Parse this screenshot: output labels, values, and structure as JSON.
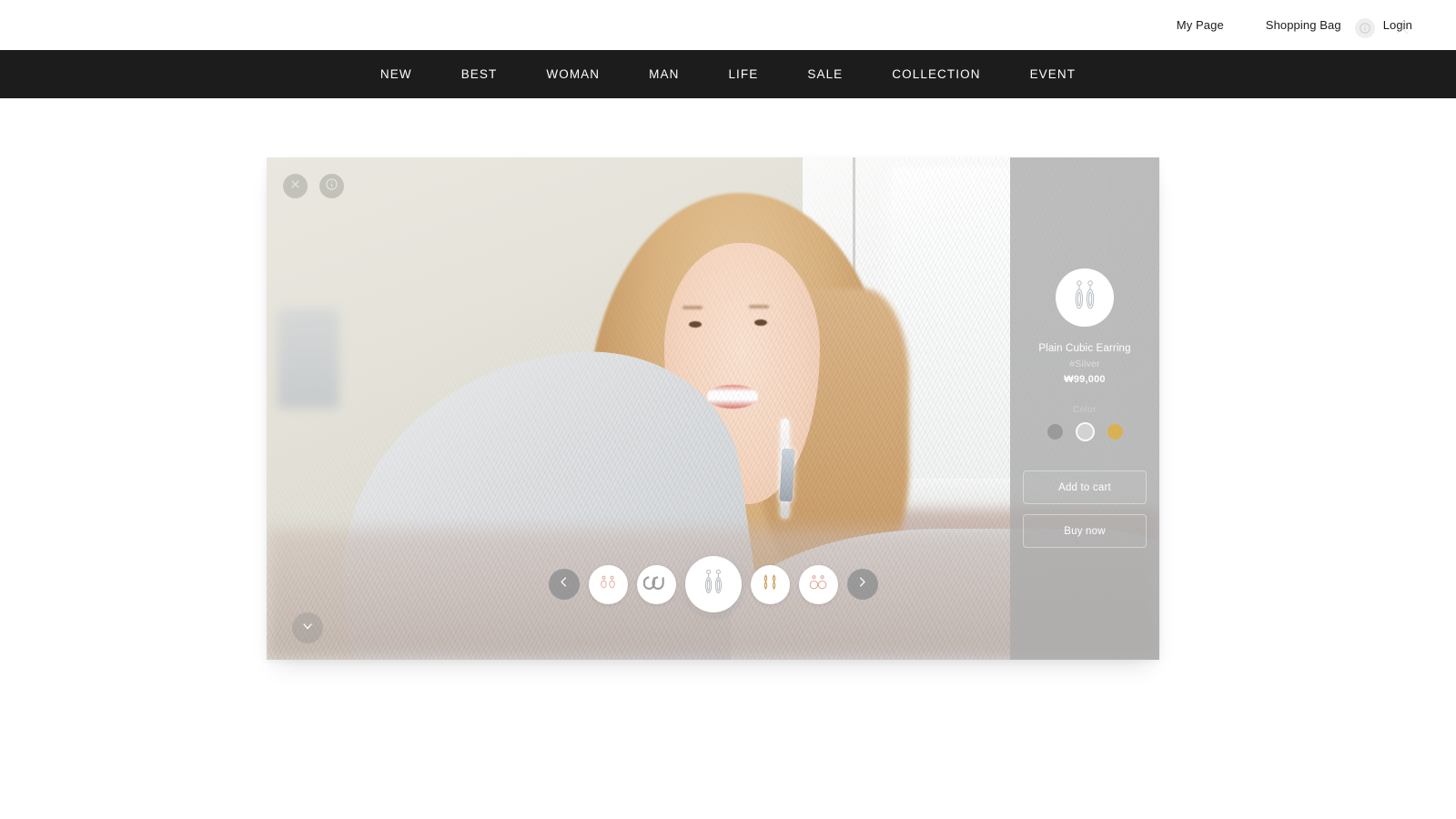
{
  "header": {
    "links": [
      {
        "label": "My Page"
      },
      {
        "label": "Shopping Bag"
      },
      {
        "label": "Login"
      }
    ],
    "overlay_icons": {
      "info": "info-circle-icon",
      "close": "close-icon"
    }
  },
  "nav": {
    "items": [
      {
        "label": "NEW"
      },
      {
        "label": "BEST"
      },
      {
        "label": "WOMAN"
      },
      {
        "label": "MAN"
      },
      {
        "label": "LIFE"
      },
      {
        "label": "SALE"
      },
      {
        "label": "COLLECTION"
      },
      {
        "label": "EVENT"
      }
    ],
    "background": "#1c1c1c",
    "text_color": "#ffffff"
  },
  "viewer": {
    "controls": {
      "close": "close-icon",
      "info": "info-circle-icon",
      "scroll_down": "chevron-down-icon",
      "prev": "chevron-left-icon",
      "next": "chevron-right-icon"
    },
    "thumbnails": [
      {
        "name": "rose-drop-earring",
        "active": false
      },
      {
        "name": "silver-hoop-earring",
        "active": false
      },
      {
        "name": "plain-cubic-earring",
        "active": true
      },
      {
        "name": "gold-twist-earring",
        "active": false
      },
      {
        "name": "rose-hoop-earring",
        "active": false
      }
    ]
  },
  "product": {
    "thumb_icon": "earring-pair-icon",
    "title": "Plain Cubic Earring",
    "tag": "#Silver",
    "price": "₩99,000",
    "color_label": "Color",
    "colors": [
      {
        "name": "gray",
        "hex": "#9a9a9a",
        "selected": false
      },
      {
        "name": "silver",
        "hex": "#d2d2d2",
        "selected": true
      },
      {
        "name": "gold",
        "hex": "#d9b152",
        "selected": false
      }
    ],
    "actions": {
      "add_to_cart": "Add to cart",
      "buy_now": "Buy now"
    }
  }
}
